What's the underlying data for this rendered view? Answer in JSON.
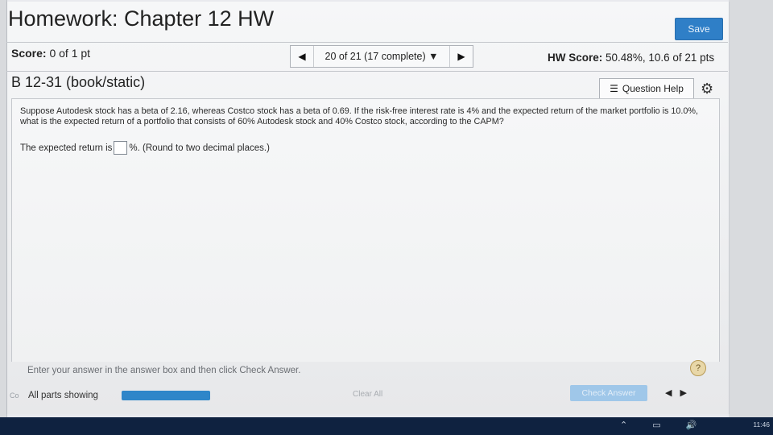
{
  "header": {
    "title": "Homework: Chapter 12 HW",
    "save_label": "Save"
  },
  "score": {
    "label": "Score:",
    "value": "0 of 1 pt"
  },
  "navigator": {
    "prev_icon": "◀",
    "position": "20 of 21 (17 complete) ▼",
    "next_icon": "▶"
  },
  "hw_score": {
    "label": "HW Score:",
    "value": "50.48%, 10.6 of 21 pts"
  },
  "question": {
    "id": "B 12-31 (book/static)",
    "help_label": "Question Help",
    "help_icon": "☰",
    "settings_icon": "⚙",
    "text": "Suppose Autodesk stock has a beta of 2.16, whereas Costco stock has a beta of 0.69. If the risk-free interest rate is 4% and the expected return of the market portfolio is 10.0%, what is the expected return of a portfolio that consists of 60% Autodesk stock and 40% Costco stock, according to the CAPM?",
    "answer_prefix": "The expected return is",
    "answer_value": "",
    "answer_suffix": "%.  (Round to two decimal places.)"
  },
  "footer": {
    "instruction": "Enter your answer in the answer box and then click Check Answer.",
    "info_icon": "?",
    "co_label": "Co",
    "parts_label": "All parts showing",
    "clear_all_label": "Clear All",
    "check_answer_label": "Check Answer",
    "pager_prev": "◀",
    "pager_next": "▶"
  },
  "taskbar": {
    "clock": "11:46",
    "tray": "⌃ ▭ 🔊"
  },
  "colors": {
    "accent": "#2f7fc7",
    "progress": "#2f86c9",
    "check_disabled": "#9fc7e9"
  }
}
